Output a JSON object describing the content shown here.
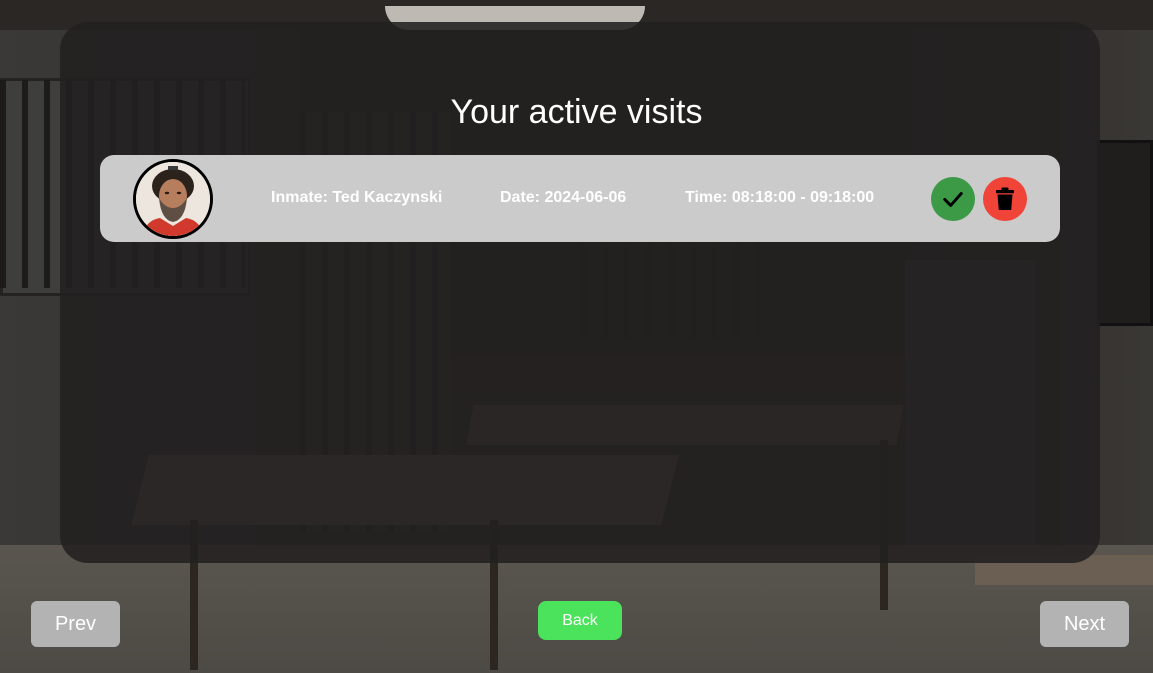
{
  "page": {
    "title": "Your active visits"
  },
  "visits": [
    {
      "inmate": "Inmate: Ted Kaczynski",
      "date": "Date: 2024-06-06",
      "time": "Time: 08:18:00 - 09:18:00",
      "actions": {
        "accept_icon": "checkmark-icon",
        "delete_icon": "trash-icon"
      }
    }
  ],
  "navigation": {
    "prev_label": "Prev",
    "back_label": "Back",
    "next_label": "Next"
  },
  "colors": {
    "accept": "#3c9a47",
    "delete": "#ef4437",
    "back_button": "#4be35b",
    "nav_button": "#b3b3b3",
    "card": "#cbcbcb"
  }
}
